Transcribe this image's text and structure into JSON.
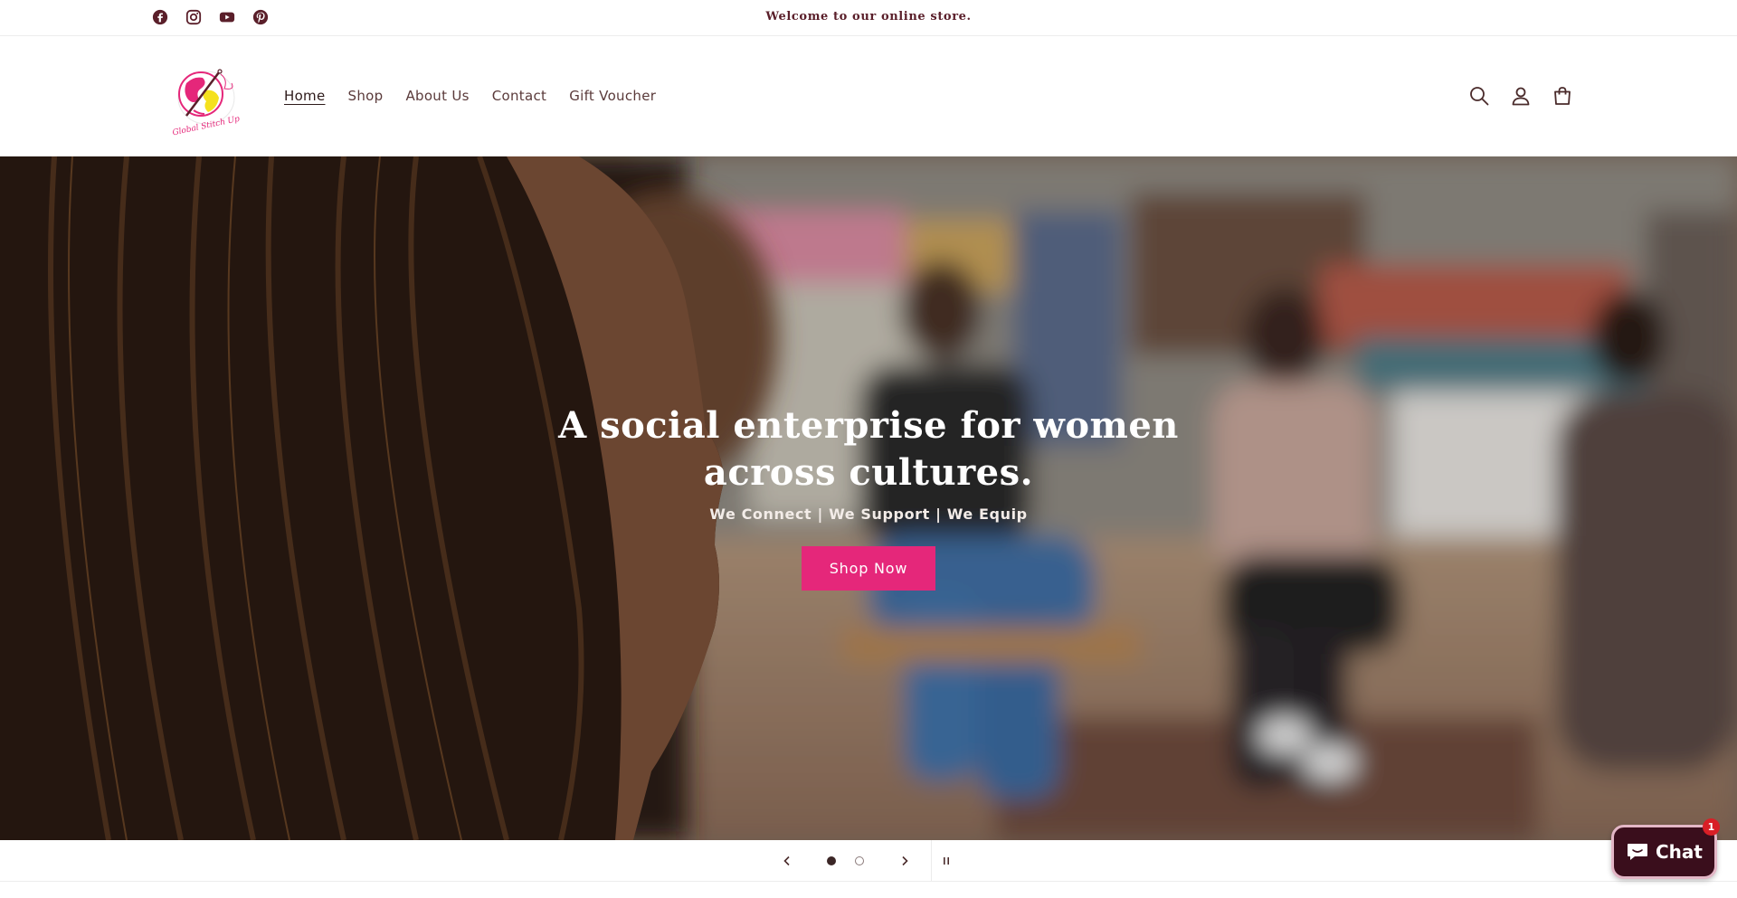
{
  "announcement": {
    "text": "Welcome to our online store.",
    "social_icons": [
      "facebook-icon",
      "instagram-icon",
      "youtube-icon",
      "pinterest-icon"
    ]
  },
  "header": {
    "logo_text": "Global Stitch Up",
    "nav": [
      {
        "label": "Home",
        "active": true
      },
      {
        "label": "Shop",
        "active": false
      },
      {
        "label": "About Us",
        "active": false
      },
      {
        "label": "Contact",
        "active": false
      },
      {
        "label": "Gift Voucher",
        "active": false
      }
    ],
    "icons": [
      "search-icon",
      "account-icon",
      "cart-icon"
    ]
  },
  "hero": {
    "title_line1": "A social enterprise for women",
    "title_line2": "across cultures.",
    "subtitle": "We Connect | We Support | We Equip",
    "button_label": "Shop Now"
  },
  "slider": {
    "slide_count": 2,
    "current_slide": 1,
    "controls": [
      "chevron-left-icon",
      "chevron-right-icon",
      "pause-icon"
    ]
  },
  "chat": {
    "label": "Chat",
    "badge_count": "1"
  },
  "colors": {
    "accent_pink": "#e5277a",
    "heading_maroon": "#5a1f2a",
    "chat_bg": "#3a0e1c",
    "badge_red": "#d81f26"
  }
}
